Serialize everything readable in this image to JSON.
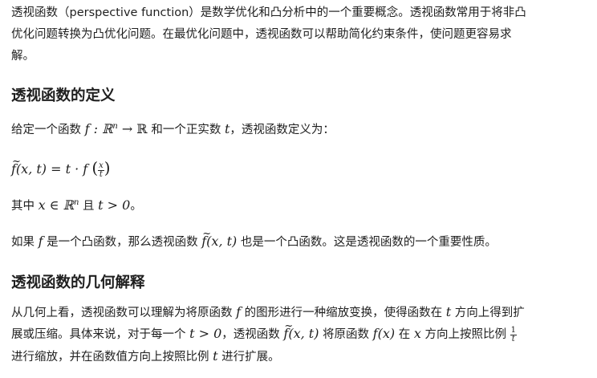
{
  "intro": {
    "line1": "透视函数（perspective function）是数学优化和凸分析中的一个重要概念。透视函数常用于将非凸",
    "line2": "优化问题转换为凸优化问题。在最优化问题中，透视函数可以帮助简化约束条件，使问题更容易求",
    "line3": "解。"
  },
  "section1": {
    "heading": "透视函数的定义",
    "given_a": "给定一个函数 ",
    "given_map": "f : ℝ",
    "given_arrow": " → ℝ",
    "given_b": " 和一个正实数 ",
    "given_t": "t",
    "given_c": "，透视函数定义为：",
    "formula_f": "f",
    "formula_rest": "(x, t) = t · f ",
    "formula_num": "x",
    "formula_den": "t",
    "where_a": "其中 ",
    "where_x": "x ∈ ℝ",
    "where_b": " 且 ",
    "where_t": "t > 0",
    "where_c": "。",
    "convex_a": "如果 ",
    "convex_f": "f",
    "convex_b": " 是一个凸函数，那么透视函数 ",
    "convex_ft": "(x, t)",
    "convex_c": " 也是一个凸函数。这是透视函数的一个重要性质。",
    "sup_n": "n"
  },
  "section2": {
    "heading": "透视函数的几何解释",
    "l1a": "从几何上看，透视函数可以理解为将原函数 ",
    "l1f": "f",
    "l1b": " 的图形进行一种缩放变换，使得函数在 ",
    "l1t": "t",
    "l1c": " 方向上得到扩",
    "l2a": "展或压缩。具体来说，对于每一个 ",
    "l2t": "t > 0",
    "l2b": "，透视函数 ",
    "l2ft": "(x, t)",
    "l2c": " 将原函数 ",
    "l2fx": "f(x)",
    "l2d": " 在 ",
    "l2x": "x",
    "l2e": " 方向上按照比例 ",
    "l2num": "1",
    "l2den": "t",
    "l3a": "进行缩放，并在函数值方向上按照比例 ",
    "l3t": "t",
    "l3b": " 进行扩展。"
  }
}
